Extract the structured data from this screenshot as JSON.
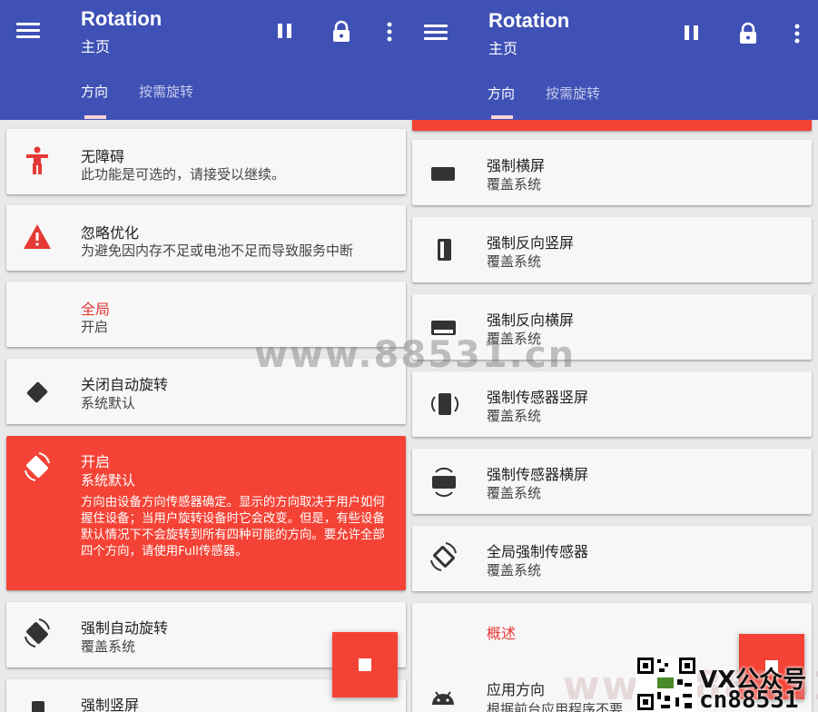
{
  "left": {
    "appbar": {
      "title": "Rotation",
      "subtitle": "主页",
      "tabs": [
        "方向",
        "按需旋转"
      ]
    },
    "items": [
      {
        "icon": "accessibility-icon",
        "title": "无障碍",
        "subtitle": "此功能是可选的，请接受以继续。"
      },
      {
        "icon": "warning-icon",
        "title": "忽略优化",
        "subtitle": "为避免因内存不足或电池不足而导致服务中断"
      },
      {
        "icon": "",
        "title": "全局",
        "subtitle": "开启"
      },
      {
        "icon": "screen-rotation-off-icon",
        "title": "关闭自动旋转",
        "subtitle": "系统默认"
      },
      {
        "icon": "screen-rotation-icon",
        "title": "开启",
        "subtitle": "系统默认",
        "description": "方向由设备方向传感器确定。显示的方向取决于用户如何握住设备；当用户旋转设备时它会改变。但是，有些设备默认情况下不会旋转到所有四种可能的方向。要允许全部四个方向，请使用Full传感器。"
      },
      {
        "icon": "screen-rotation-icon",
        "title": "强制自动旋转",
        "subtitle": "覆盖系统"
      },
      {
        "icon": "portrait-icon",
        "title": "强制竖屏",
        "subtitle": ""
      }
    ]
  },
  "right": {
    "appbar": {
      "title": "Rotation",
      "subtitle": "主页",
      "tabs": [
        "方向",
        "按需旋转"
      ]
    },
    "items": [
      {
        "icon": "landscape-icon",
        "title": "强制横屏",
        "subtitle": "覆盖系统"
      },
      {
        "icon": "reverse-portrait-icon",
        "title": "强制反向竖屏",
        "subtitle": "覆盖系统"
      },
      {
        "icon": "reverse-landscape-icon",
        "title": "强制反向横屏",
        "subtitle": "覆盖系统"
      },
      {
        "icon": "sensor-portrait-icon",
        "title": "强制传感器竖屏",
        "subtitle": "覆盖系统"
      },
      {
        "icon": "sensor-landscape-icon",
        "title": "强制传感器横屏",
        "subtitle": "覆盖系统"
      },
      {
        "icon": "full-sensor-icon",
        "title": "全局强制传感器",
        "subtitle": "覆盖系统"
      },
      {
        "icon": "android-icon",
        "header": "概述",
        "title": "应用方向",
        "subtitle": "根据前台应用程序不要"
      }
    ]
  },
  "watermark": {
    "main": "www.88531.cn",
    "bottom": "www.88531",
    "vx_line1": "VX公众号",
    "vx_line2": "cn88531"
  },
  "colors": {
    "appbar": "#3f51b5",
    "accent": "#f44336",
    "tab_indicator": "#fbd3d8"
  }
}
